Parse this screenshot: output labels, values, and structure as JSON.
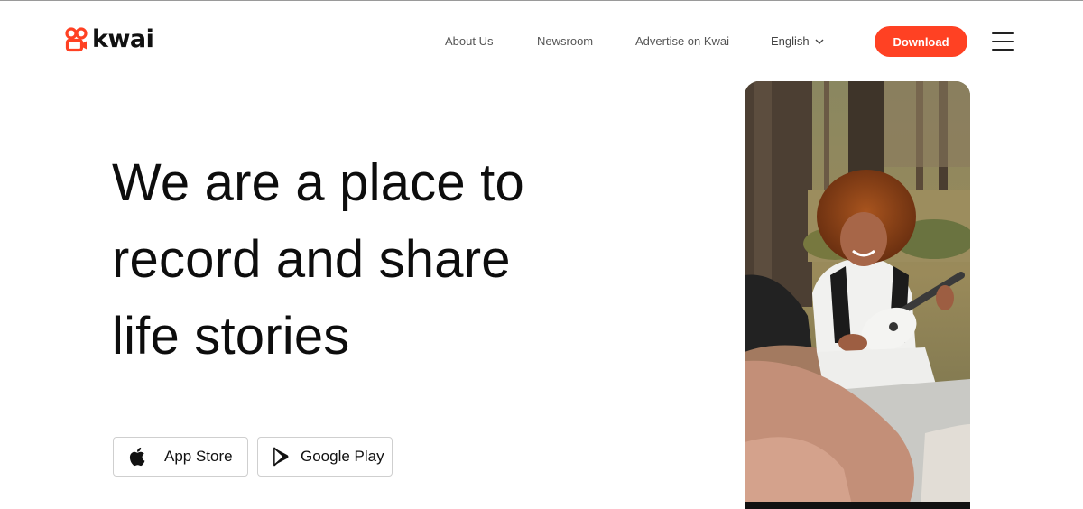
{
  "brand": {
    "name": "kwai",
    "accent": "#ff4123"
  },
  "nav": {
    "about": "About Us",
    "newsroom": "Newsroom",
    "advertise": "Advertise on Kwai",
    "language": "English"
  },
  "header": {
    "download_label": "Download",
    "menu_icon": "hamburger-menu-icon"
  },
  "hero": {
    "title_lines": [
      "We are a place to",
      "record and share",
      "life stories"
    ],
    "photo": "girl-playing-ukulele-photo"
  },
  "stores": {
    "app_store": {
      "label": "App Store",
      "icon": "apple-icon"
    },
    "google_play": {
      "label": "Google Play",
      "icon": "google-play-icon"
    }
  }
}
